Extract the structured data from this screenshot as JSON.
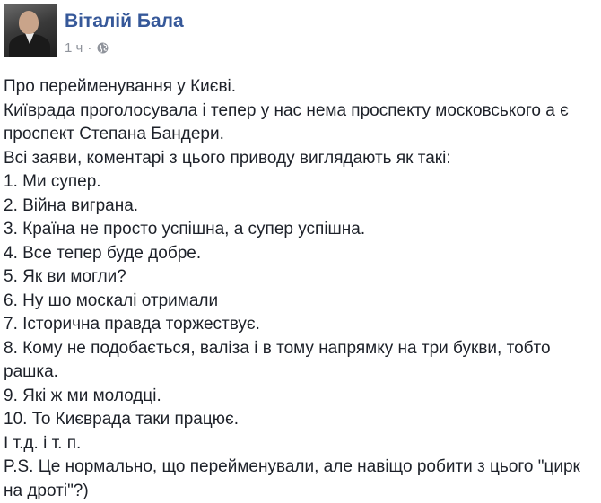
{
  "post": {
    "author": "Віталій Бала",
    "time": "1 ч",
    "separator": "·",
    "privacy_icon": "globe-icon",
    "lines": [
      "Про перейменування у Києві.",
      "Київрада проголосувала і тепер у нас нема проспекту московського а є проспект Степана Бандери.",
      "Всі заяви, коментарі з цього приводу виглядають як такі:",
      "1. Ми супер.",
      "2. Війна виграна.",
      "3. Країна не просто успішна, а супер успішна.",
      "4. Все тепер буде добре.",
      "5. Як ви могли?",
      "6. Ну шо москалі отримали",
      "7. Історична правда торжествує.",
      "8. Кому не подобається, валіза і в тому напрямку на три букви, тобто рашка.",
      "9. Які ж ми молодці.",
      "10. То Києврада таки працює.",
      "І т.д. і т. п.",
      "P.S. Це нормально, що перейменували, але навіщо робити з цього \"цирк на дроті\"?)"
    ]
  },
  "colors": {
    "author_link": "#365899",
    "meta_text": "#90949c",
    "body_text": "#1d2129"
  }
}
